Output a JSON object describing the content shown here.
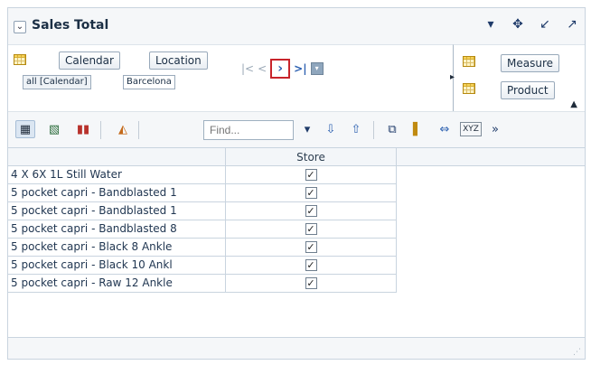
{
  "title": "Sales Total",
  "title_icons": [
    "dropdown-icon",
    "move-icon",
    "minimize-icon",
    "maximize-icon"
  ],
  "pivot": {
    "columns_chips": [
      "Calendar",
      "Location"
    ],
    "filter_chips": [
      "all [Calendar]",
      "Barcelona"
    ],
    "rows_chips": [
      "Measure",
      "Product"
    ]
  },
  "toolbar": {
    "find_placeholder": "Find...",
    "more": "»"
  },
  "table": {
    "column_header": "Store",
    "rows": [
      {
        "label": "4 X 6X 1L Still Water",
        "checked": true
      },
      {
        "label": "5 pocket capri - Bandblasted 1",
        "checked": true
      },
      {
        "label": "5 pocket capri - Bandblasted 1",
        "checked": true
      },
      {
        "label": "5 pocket capri - Bandblasted 8",
        "checked": true
      },
      {
        "label": "5 pocket capri - Black 8 Ankle",
        "checked": true
      },
      {
        "label": "5 pocket capri - Black 10 Ankl",
        "checked": true
      },
      {
        "label": "5 pocket capri - Raw 12 Ankle",
        "checked": true
      }
    ]
  },
  "colors": {
    "accent": "#2b5fb0",
    "highlight": "#c8242b"
  }
}
